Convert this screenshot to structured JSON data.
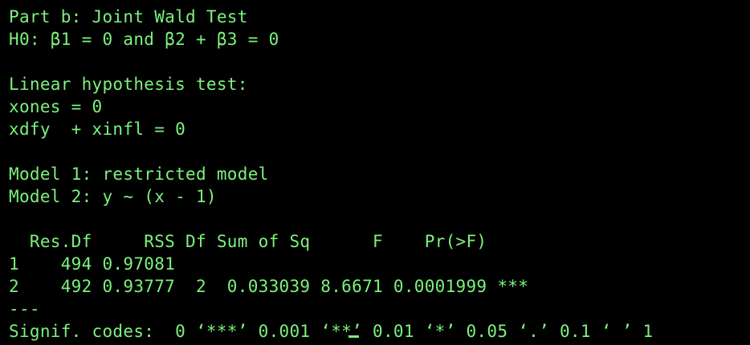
{
  "terminal": {
    "lines": [
      "Part b: Joint Wald Test",
      "H0: β1 = 0 and β2 + β3 = 0",
      "",
      "Linear hypothesis test:",
      "xones = 0",
      "xdfy  + xinfl = 0",
      "",
      "Model 1: restricted model",
      "Model 2: y ~ (x - 1)",
      "",
      "  Res.Df     RSS Df Sum of Sq      F    Pr(>F)    ",
      "1    494 0.97081                                  ",
      "2    492 0.93777  2  0.033039 8.6671 0.0001999 ***",
      "---",
      "Signif. codes:  0 ‘***’ 0.001 ‘**’ 0.01 ‘*’ 0.05 ‘.’ 0.1 ‘ ’ 1"
    ]
  },
  "colors": {
    "background": "#000000",
    "text": "#7cf27c"
  }
}
